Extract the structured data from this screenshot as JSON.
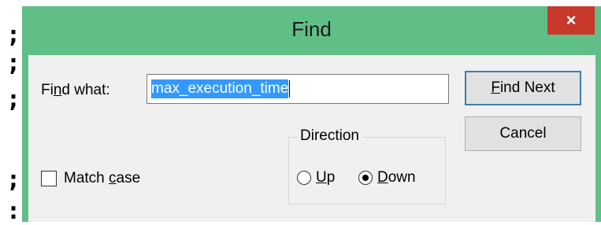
{
  "background": {
    "glyphs": [
      ";",
      ";",
      ";",
      ";",
      ":"
    ]
  },
  "window": {
    "title": "Find",
    "close_glyph": "×",
    "colors": {
      "frame": "#5fbf87",
      "close": "#c8392c",
      "client": "#f0f0f0",
      "selection": "#3399ff"
    }
  },
  "find_what": {
    "label_before": "Fi",
    "label_mnemonic": "n",
    "label_after": "d what:",
    "value": "max_execution_time"
  },
  "buttons": {
    "find_next_mnemonic": "F",
    "find_next_rest": "ind Next",
    "cancel": "Cancel"
  },
  "direction": {
    "legend": "Direction",
    "up_mnemonic": "U",
    "up_rest": "p",
    "up_selected": false,
    "down_mnemonic": "D",
    "down_rest": "own",
    "down_selected": true
  },
  "match_case": {
    "label_before": "Match ",
    "label_mnemonic": "c",
    "label_after": "ase",
    "checked": false
  }
}
